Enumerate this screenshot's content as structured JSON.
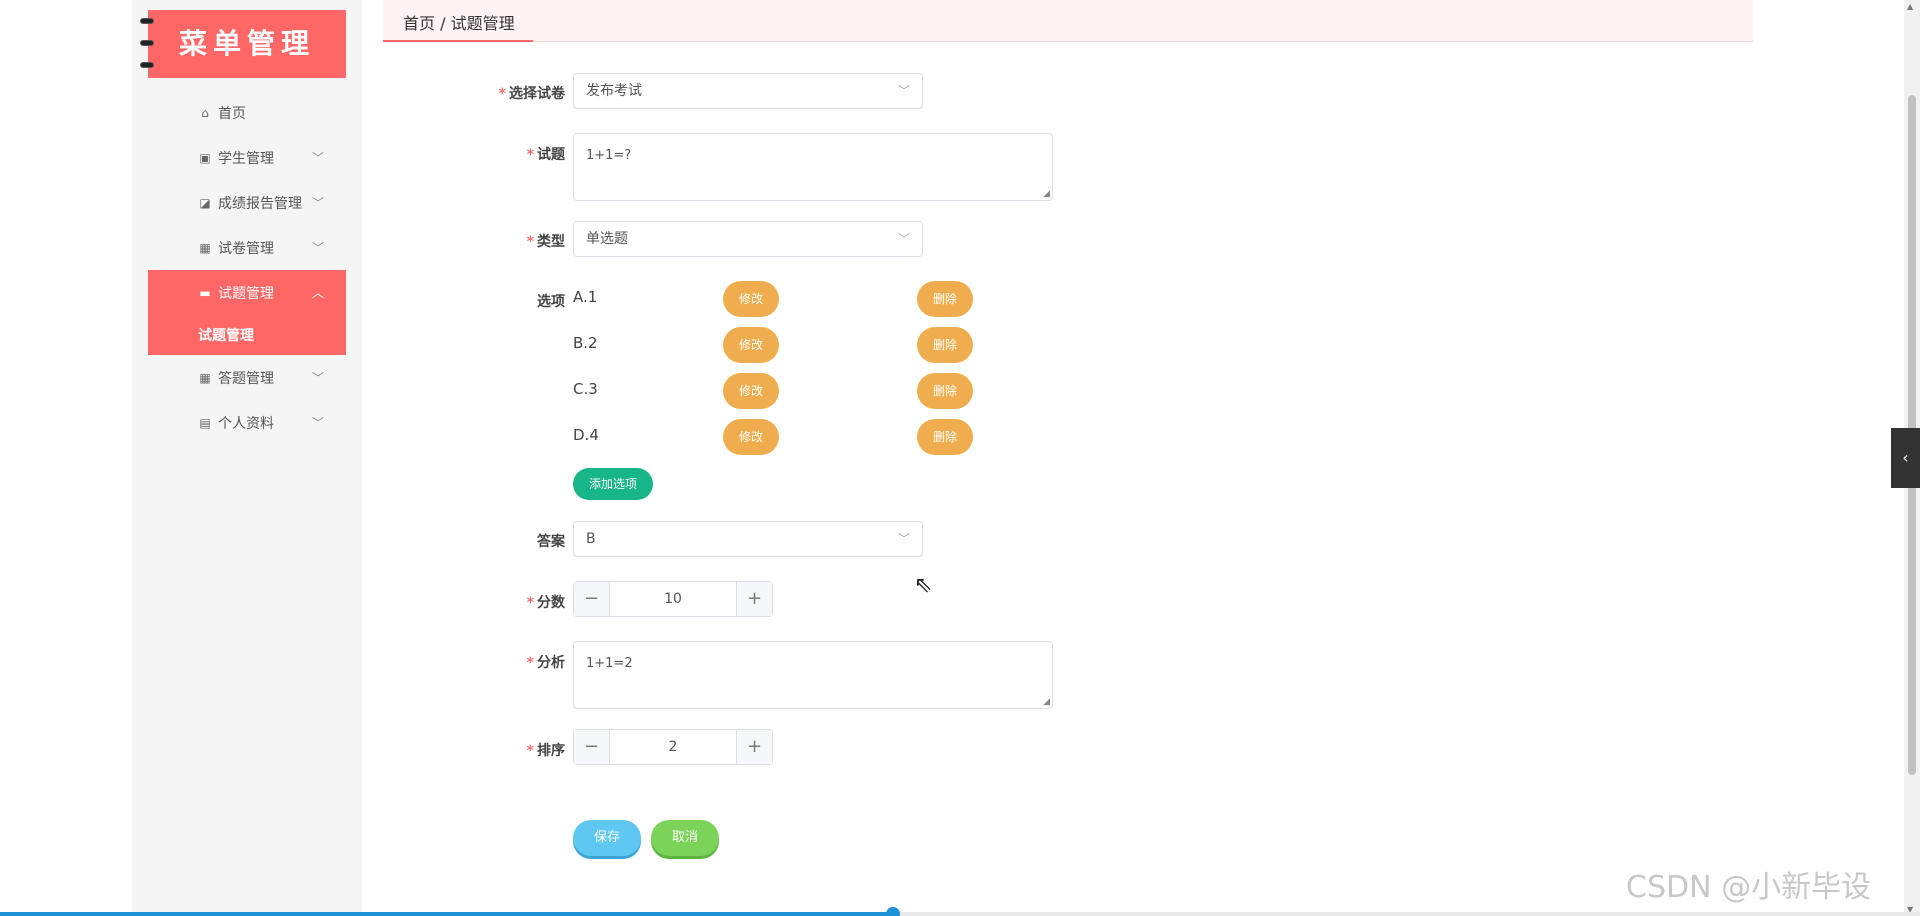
{
  "sidebar": {
    "logo_text": "菜单管理",
    "items": [
      {
        "label": "首页",
        "icon": "home-icon",
        "glyph": "⌂",
        "has_children": false
      },
      {
        "label": "学生管理",
        "icon": "clipboard-icon",
        "glyph": "▣",
        "has_children": true
      },
      {
        "label": "成绩报告管理",
        "icon": "chart-icon",
        "glyph": "◪",
        "has_children": true
      },
      {
        "label": "试卷管理",
        "icon": "grid-icon",
        "glyph": "▦",
        "has_children": true
      },
      {
        "label": "试题管理",
        "icon": "monitor-icon",
        "glyph": "▬",
        "has_children": true,
        "active": true,
        "submenu": [
          "试题管理"
        ]
      },
      {
        "label": "答题管理",
        "icon": "grid-icon",
        "glyph": "▦",
        "has_children": true
      },
      {
        "label": "个人资料",
        "icon": "calendar-icon",
        "glyph": "▤",
        "has_children": true
      }
    ]
  },
  "breadcrumb": {
    "text": "首页 / 试题管理"
  },
  "form": {
    "paper": {
      "label": "选择试卷",
      "value": "发布考试"
    },
    "question": {
      "label": "试题",
      "value": "1+1=?"
    },
    "type": {
      "label": "类型",
      "value": "单选题"
    },
    "options": {
      "label": "选项",
      "items": [
        "A.1",
        "B.2",
        "C.3",
        "D.4"
      ],
      "edit_label": "修改",
      "delete_label": "删除",
      "add_label": "添加选项"
    },
    "answer": {
      "label": "答案",
      "value": "B"
    },
    "score": {
      "label": "分数",
      "value": "10"
    },
    "analysis": {
      "label": "分析",
      "value": "1+1=2"
    },
    "sort": {
      "label": "排序",
      "value": "2"
    },
    "save_label": "保存",
    "cancel_label": "取消"
  },
  "watermark": "CSDN @小新毕设",
  "video_progress": 0.465,
  "colors": {
    "accent": "#ff6666",
    "orange": "#f0ad4e",
    "green": "#16b688",
    "save": "#5ec8f2",
    "cancel": "#7bd35a"
  }
}
